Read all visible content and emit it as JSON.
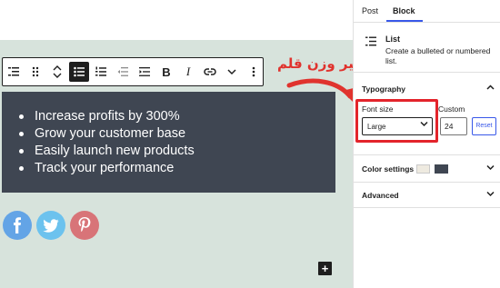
{
  "editor": {
    "list_items": [
      "Increase profits by 300%",
      "Grow your customer base",
      "Easily launch new products",
      "Track your performance"
    ],
    "add_block": "+"
  },
  "toolbar": {
    "icons": [
      "list-block-icon",
      "drag-handle-icon",
      "move-up-down-icon",
      "unordered-list-icon",
      "ordered-list-icon",
      "outdent-icon",
      "indent-icon",
      "bold-icon",
      "italic-icon",
      "link-icon",
      "more-chevron-icon",
      "options-icon"
    ],
    "bold": "B",
    "italic": "I"
  },
  "annotation": {
    "text": "تغییر وزن قلم",
    "color": "#e0332e"
  },
  "social": [
    "facebook-icon",
    "twitter-icon",
    "pinterest-icon"
  ],
  "sidebar": {
    "tabs": {
      "post": "Post",
      "block": "Block"
    },
    "block_card": {
      "title": "List",
      "description": "Create a bulleted or numbered list."
    },
    "typography": {
      "title": "Typography",
      "font_size_label": "Font size",
      "custom_label": "Custom",
      "font_size_value": "Large",
      "custom_value": "24",
      "reset_label": "Reset"
    },
    "color_settings": {
      "title": "Color settings",
      "colors": [
        "#eeeae0",
        "#3f4652"
      ]
    },
    "advanced": {
      "title": "Advanced"
    }
  },
  "colors": {
    "accent": "#3858e9",
    "highlight": "#e3242b",
    "list_bg": "#3f4652",
    "canvas_bg": "#d7e3dc"
  }
}
